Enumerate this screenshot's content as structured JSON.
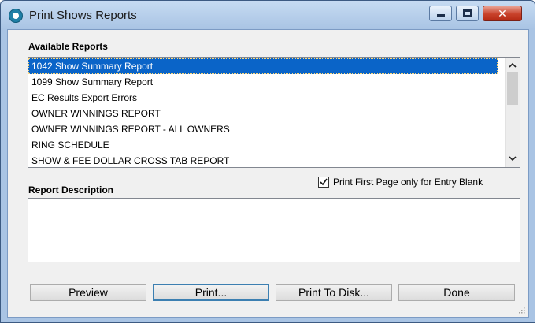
{
  "window": {
    "title": "Print Shows Reports",
    "close_glyph": "✕"
  },
  "available_reports": {
    "label": "Available Reports",
    "items": [
      "1042 Show Summary Report",
      "1099 Show Summary Report",
      "EC Results Export Errors",
      "OWNER WINNINGS REPORT",
      "OWNER WINNINGS REPORT - ALL OWNERS",
      "RING SCHEDULE",
      "SHOW & FEE DOLLAR CROSS TAB REPORT"
    ],
    "selected": "1042 Show Summary Report"
  },
  "report_description": {
    "label": "Report Description",
    "value": ""
  },
  "print_first_page": {
    "label": "Print First Page only for Entry Blank",
    "checked": true
  },
  "buttons": {
    "preview": "Preview",
    "print": "Print...",
    "print_to_disk": "Print To Disk...",
    "done": "Done"
  },
  "colors": {
    "selection": "#0a64c8",
    "frame": "#a9c4e4",
    "client": "#f0f0f0"
  },
  "icons": {
    "app": "app-logo-icon",
    "minimize": "minimize-icon",
    "maximize": "maximize-icon",
    "close": "close-icon",
    "scroll_up": "chevron-up-icon",
    "scroll_down": "chevron-down-icon",
    "check": "checkmark-icon"
  }
}
